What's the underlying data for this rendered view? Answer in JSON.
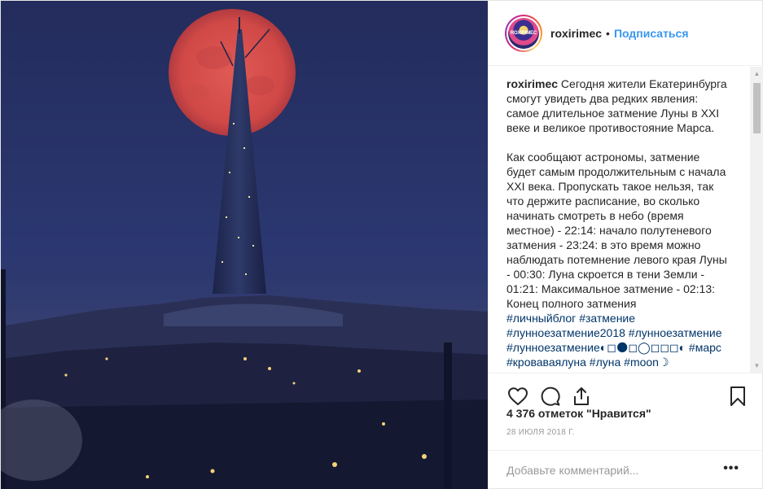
{
  "post": {
    "username": "roxirimec",
    "separator": "•",
    "follow_label": "Подписаться",
    "avatar_text": "ROXIRIMEC",
    "caption": {
      "author": "roxirimec",
      "text": " Сегодня жители Екатеринбурга смогут увидеть два редких явления: самое длительное затмение Луны в XXI веке и великое противостояние Марса.\n\nКак сообщают астрономы, затмение будет самым продолжительным с начала XXI века. Пропускать такое нельзя, так что держите расписание, во сколько начинать смотреть в небо (время местное) - 22:14: начало полутеневого затмения - 23:24: в это время можно наблюдать потемнение левого края Луны - 00:30: Луна скроется в тени Земли - 01:21: Максимальное затмение - 02:13: Конец полного затмения\n",
      "tags": [
        "#личныйблог",
        "#затмение",
        "#лунноезатмение2018",
        "#лунноезатмение",
        "#лунноезатмение◐◻🌑◻◯◻◻◻◐",
        "#марс",
        "#кроваваялуна",
        "#луна",
        "#moon☽"
      ]
    },
    "likes_text": "4 376 отметок \"Нравится\"",
    "date": "28 июля 2018 г.",
    "comment_placeholder": "Добавьте комментарий...",
    "more_label": "•••",
    "icons": {
      "like": "heart-icon",
      "comment": "comment-bubble-icon",
      "share": "share-icon",
      "save": "bookmark-icon",
      "more": "more-options-icon"
    },
    "colors": {
      "accent": "#3897f0",
      "hashtag": "#003569",
      "sky": "#2a356a",
      "moon": "#d24a48"
    }
  }
}
